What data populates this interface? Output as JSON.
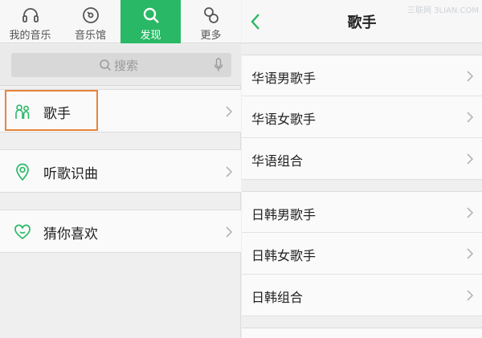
{
  "tabs": [
    {
      "label": "我的音乐",
      "icon": "headphones-icon",
      "active": false
    },
    {
      "label": "音乐馆",
      "icon": "disc-icon",
      "active": false
    },
    {
      "label": "发现",
      "icon": "search-icon",
      "active": true
    },
    {
      "label": "更多",
      "icon": "more-icon",
      "active": false
    }
  ],
  "search": {
    "placeholder": "搜索"
  },
  "menu": [
    {
      "label": "歌手",
      "icon": "singer-icon"
    },
    {
      "label": "听歌识曲",
      "icon": "location-pin-icon"
    },
    {
      "label": "猜你喜欢",
      "icon": "heart-icon"
    }
  ],
  "detail": {
    "title": "歌手",
    "watermark": "三联网 3LIAN.COM",
    "groups": [
      [
        "华语男歌手",
        "华语女歌手",
        "华语组合"
      ],
      [
        "日韩男歌手",
        "日韩女歌手",
        "日韩组合"
      ]
    ]
  },
  "colors": {
    "accent": "#29b865",
    "highlight": "#e8833a"
  }
}
